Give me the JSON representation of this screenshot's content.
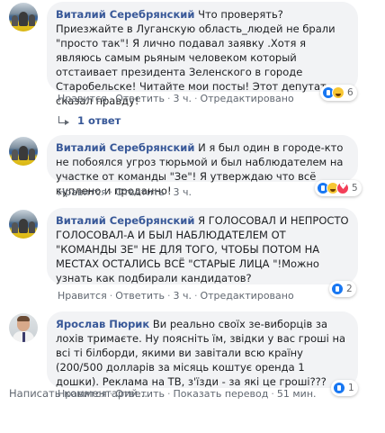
{
  "comments": [
    {
      "author": "Виталий Серебрянский",
      "text": "Что проверять? Приезжайте в Луганскую область_людей не брали \"просто так\"! Я лично подавал заявку .Хотя я являюсь самым рьяным человеком который отстаивает президента Зеленского в городе Старобельске! Читайте мои посты! Этот депутат сказал правду!",
      "actions": {
        "like": "Нравится",
        "reply": "Ответить",
        "time": "3 ч.",
        "extra": "Отредактировано"
      },
      "reactions": {
        "icons": [
          "like-icon",
          "haha-icon"
        ],
        "count": "6"
      },
      "replies": "1 ответ"
    },
    {
      "author": "Виталий Серебрянский",
      "text": "И я был один в городе-кто не побоялся угроз тюрьмой и был наблюдателем на участке от команды \"Зе\"! Я утверждаю что всё куплено и проданно!",
      "actions": {
        "like": "Нравится",
        "reply": "Ответить",
        "time": "3 ч."
      },
      "reactions": {
        "icons": [
          "like-icon",
          "haha-icon",
          "love-icon"
        ],
        "count": "5"
      }
    },
    {
      "author": "Виталий Серебрянский",
      "text": "Я ГОЛОСОВАЛ И НЕПРОСТО ГОЛОСОВАЛ-А И БЫЛ НАБЛЮДАТЕЛЕМ ОТ \"КОМАНДЫ ЗЕ\" НЕ ДЛЯ ТОГО, ЧТОБЫ ПОТОМ НА МЕСТАХ ОСТАЛИСЬ ВСЁ \"СТАРЫЕ ЛИЦА \"!Можно узнать как подбирали кандидатов?",
      "actions": {
        "like": "Нравится",
        "reply": "Ответить",
        "time": "3 ч.",
        "extra": "Отредактировано"
      },
      "reactions": {
        "icons": [
          "like-icon"
        ],
        "count": "2"
      }
    },
    {
      "author": "Ярослав Пюрик",
      "text": "Ви реально своїх зе-виборців за лохів тримаєте. Ну поясніть їм, звідки у вас гроші на всі ті білборди, якими ви завітали всю країну (200/500 долларів за місяць коштує оренда 1 дошки). Реклама на ТВ, з'їзди - за які це гроші???",
      "actions": {
        "like": "Нравится",
        "reply": "Ответить",
        "translate": "Показать перевод",
        "time": "51 мин."
      },
      "reactions": {
        "icons": [
          "like-icon"
        ],
        "count": "1"
      }
    }
  ],
  "write_comment_placeholder": "Написать комментарий..."
}
